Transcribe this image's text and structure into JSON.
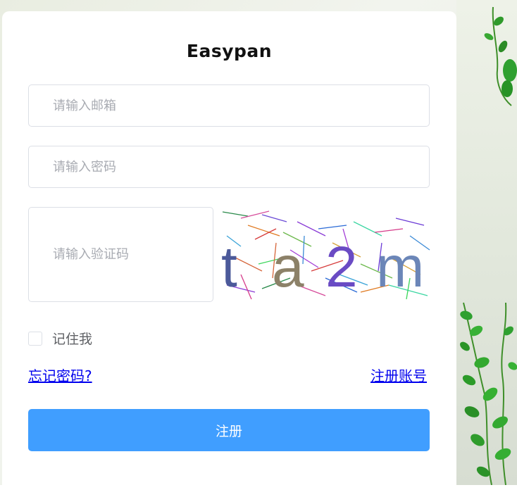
{
  "app": {
    "title": "Easypan"
  },
  "form": {
    "email_placeholder": "请输入邮箱",
    "password_placeholder": "请输入密码",
    "captcha_placeholder": "请输入验证码",
    "captcha_text": [
      "t",
      "a",
      "2",
      "m"
    ],
    "remember_label": "记住我",
    "remember_checked": false,
    "forgot_link": "忘记密码?",
    "register_link": "注册账号",
    "submit_label": "注册"
  },
  "colors": {
    "primary": "#409eff",
    "link": "#0000ee",
    "border": "#dcdfe6",
    "placeholder": "#a8abb2"
  },
  "icons": [
    "vine-leaf-decoration"
  ]
}
